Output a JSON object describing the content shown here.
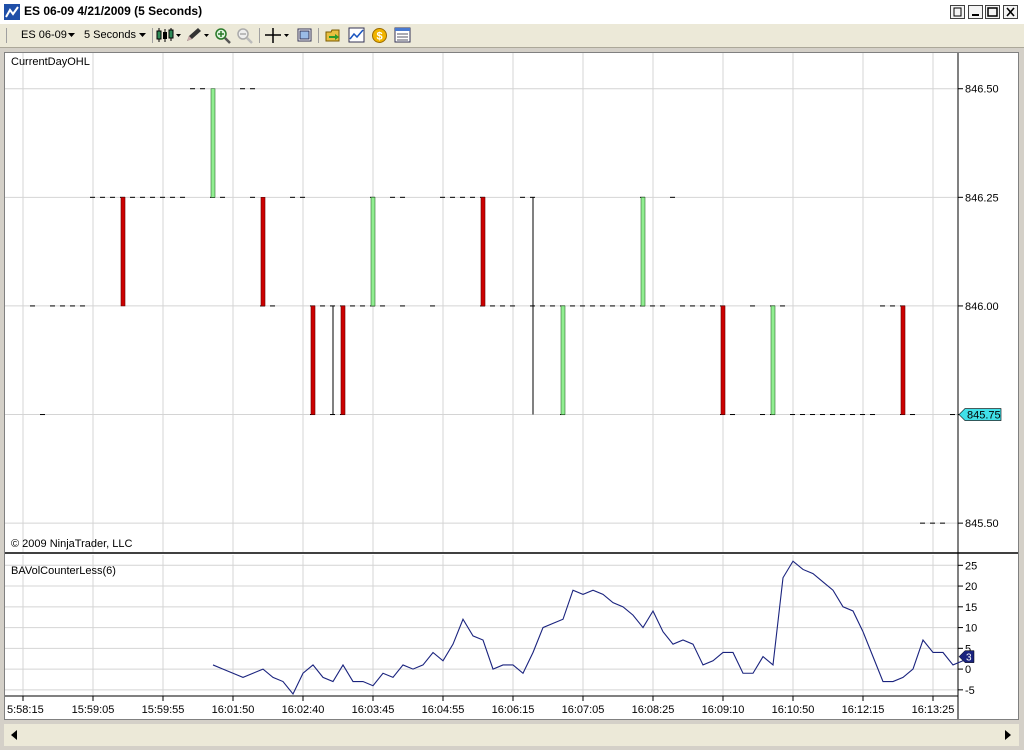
{
  "window": {
    "title": "ES 06-09  4/21/2009 (5 Seconds)"
  },
  "toolbar": {
    "instrument": "ES 06-09",
    "interval": "5 Seconds"
  },
  "chart_data": [
    {
      "type": "bar",
      "subtype": "open-high-low-close bars",
      "title": "CurrentDayOHL",
      "watermark": "© 2009 NinjaTrader, LLC",
      "ylim": [
        845.475,
        846.55
      ],
      "y_ticks": [
        "846.50",
        "846.25",
        "846.00",
        "845.75",
        "845.50"
      ],
      "last_price_label": "845.75",
      "x_tick_labels": [
        "5:58:15",
        "15:59:05",
        "15:59:55",
        "16:01:50",
        "16:02:40",
        "16:03:45",
        "16:04:55",
        "16:06:15",
        "16:07:05",
        "16:08:25",
        "16:09:10",
        "16:10:50",
        "16:12:15",
        "16:13:25"
      ],
      "colors": {
        "up": "#90ee90",
        "down": "#cc0000",
        "neutral": "#000000"
      },
      "bars": [
        {
          "slot": 10,
          "open": 846.25,
          "close": 846.0
        },
        {
          "slot": 19,
          "open": 846.25,
          "close": 846.5
        },
        {
          "slot": 24,
          "open": 846.25,
          "close": 846.0
        },
        {
          "slot": 29,
          "open": 846.0,
          "close": 845.75
        },
        {
          "slot": 31,
          "open": 846.0,
          "close": 845.75
        },
        {
          "slot": 32,
          "open": 846.0,
          "close": 845.75
        },
        {
          "slot": 35,
          "open": 846.0,
          "close": 846.25
        },
        {
          "slot": 46,
          "open": 846.25,
          "close": 846.0
        },
        {
          "slot": 51,
          "open": 846.25,
          "close": 845.75
        },
        {
          "slot": 54,
          "open": 845.75,
          "close": 846.0
        },
        {
          "slot": 62,
          "open": 846.0,
          "close": 846.25
        },
        {
          "slot": 70,
          "open": 846.0,
          "close": 845.75
        },
        {
          "slot": 75,
          "open": 845.75,
          "close": 846.0
        },
        {
          "slot": 88,
          "open": 846.0,
          "close": 845.75
        }
      ],
      "dashes": [
        {
          "y": 846.5,
          "slots": [
            17,
            18,
            22,
            23
          ]
        },
        {
          "y": 846.25,
          "slots": [
            7,
            8,
            9,
            10,
            11,
            12,
            13,
            14,
            15,
            16,
            19,
            20,
            23,
            27,
            28,
            35,
            37,
            38,
            42,
            43,
            44,
            45,
            46,
            50,
            51,
            62,
            65
          ]
        },
        {
          "y": 846.0,
          "slots": [
            1,
            3,
            4,
            5,
            6,
            24,
            25,
            29,
            30,
            31,
            32,
            33,
            34,
            35,
            36,
            38,
            41,
            46,
            47,
            48,
            49,
            51,
            52,
            53,
            54,
            55,
            56,
            57,
            58,
            59,
            60,
            61,
            62,
            63,
            64,
            66,
            67,
            68,
            69,
            70,
            73,
            75,
            76,
            86,
            87,
            88
          ]
        },
        {
          "y": 845.75,
          "slots": [
            2,
            29,
            31,
            32,
            54,
            70,
            71,
            74,
            75,
            77,
            78,
            79,
            80,
            81,
            82,
            83,
            84,
            85,
            88,
            89,
            93,
            94
          ]
        },
        {
          "y": 845.5,
          "slots": [
            90,
            91,
            92
          ]
        }
      ]
    },
    {
      "type": "line",
      "title": "BAVolCounterLess(6)",
      "ylim": [
        -6,
        27
      ],
      "y_ticks": [
        25,
        20,
        15,
        10,
        5,
        0,
        -5
      ],
      "last_value_label": "3",
      "color": "#1a237e",
      "start_slot": 19,
      "values": [
        1,
        0,
        -1,
        -2,
        -1,
        0,
        -2,
        -3,
        -6,
        -1,
        1,
        -2,
        -3,
        1,
        -3,
        -3,
        -4,
        -1,
        -2,
        1,
        0,
        1,
        4,
        2,
        6,
        12,
        8,
        7,
        0,
        1,
        1,
        -1,
        4,
        10,
        11,
        12,
        19,
        18,
        19,
        18,
        16,
        15,
        13,
        10,
        14,
        9,
        6,
        7,
        6,
        1,
        2,
        4,
        4,
        -1,
        -1,
        3,
        1,
        22,
        26,
        24,
        23,
        21,
        19,
        15,
        14,
        9,
        3,
        -3,
        -3,
        -2,
        0,
        7,
        4,
        4,
        1,
        2,
        3
      ]
    }
  ]
}
